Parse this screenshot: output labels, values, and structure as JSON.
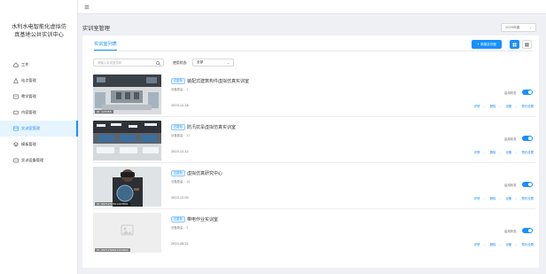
{
  "sidebar": {
    "brand_line1": "水利水电智能化虚拟仿",
    "brand_line2": "真基地公共实训中心",
    "items": [
      {
        "label": "工作",
        "icon": "home-icon"
      },
      {
        "label": "站点管理",
        "icon": "site-icon"
      },
      {
        "label": "教学管理",
        "icon": "teaching-icon"
      },
      {
        "label": "内容管理",
        "icon": "content-icon"
      },
      {
        "label": "实训室管理",
        "icon": "lab-icon",
        "active": true
      },
      {
        "label": "模板管理",
        "icon": "template-icon"
      },
      {
        "label": "实训设备管理",
        "icon": "device-icon"
      }
    ]
  },
  "header": {
    "title": "实训室管理",
    "year_select": "2025年度"
  },
  "panel": {
    "tab": "实训室列表",
    "add_button": "+ 新增实训室",
    "search_placeholder": "请输入实训室名称",
    "filter_label": "使用状态:",
    "filter_value": "全部"
  },
  "colors": {
    "accent": "#1890ff",
    "active_bg": "#e6f4ff"
  },
  "cards": [
    {
      "tag": "已发布",
      "title": "装配式建筑构件虚拟仿真实训室",
      "count": "设备数量：1",
      "date": "2023-12-28",
      "thumb_id": "ID: 123456",
      "switch_label": "启用状态",
      "enabled": true,
      "actions": [
        "详情",
        "删除",
        "设备",
        "预约设置"
      ]
    },
    {
      "tag": "已发布",
      "title": "防汛抗旱虚拟仿真实训室",
      "count": "设备数量：11",
      "date": "2023-12-12",
      "thumb_id": "",
      "switch_label": "启用状态",
      "enabled": true,
      "actions": [
        "详情",
        "删除",
        "设备",
        "预约设置"
      ]
    },
    {
      "tag": "已发布",
      "title": "虚拟仿真研究中心",
      "count": "设备数量：14",
      "date": "2023-12-05",
      "thumb_id": "ID: 9871234561203801",
      "switch_label": "启用状态",
      "enabled": true,
      "actions": [
        "详情",
        "删除",
        "设备",
        "预约设置"
      ]
    },
    {
      "tag": "已发布",
      "title": "带电作业实训室",
      "count": "设备数量：3",
      "date": "2023-08-22",
      "thumb_id": "ID: 9871234561203801",
      "switch_label": "启用状态",
      "enabled": true,
      "actions": [
        "详情",
        "删除",
        "设备",
        "预约设置"
      ]
    }
  ]
}
